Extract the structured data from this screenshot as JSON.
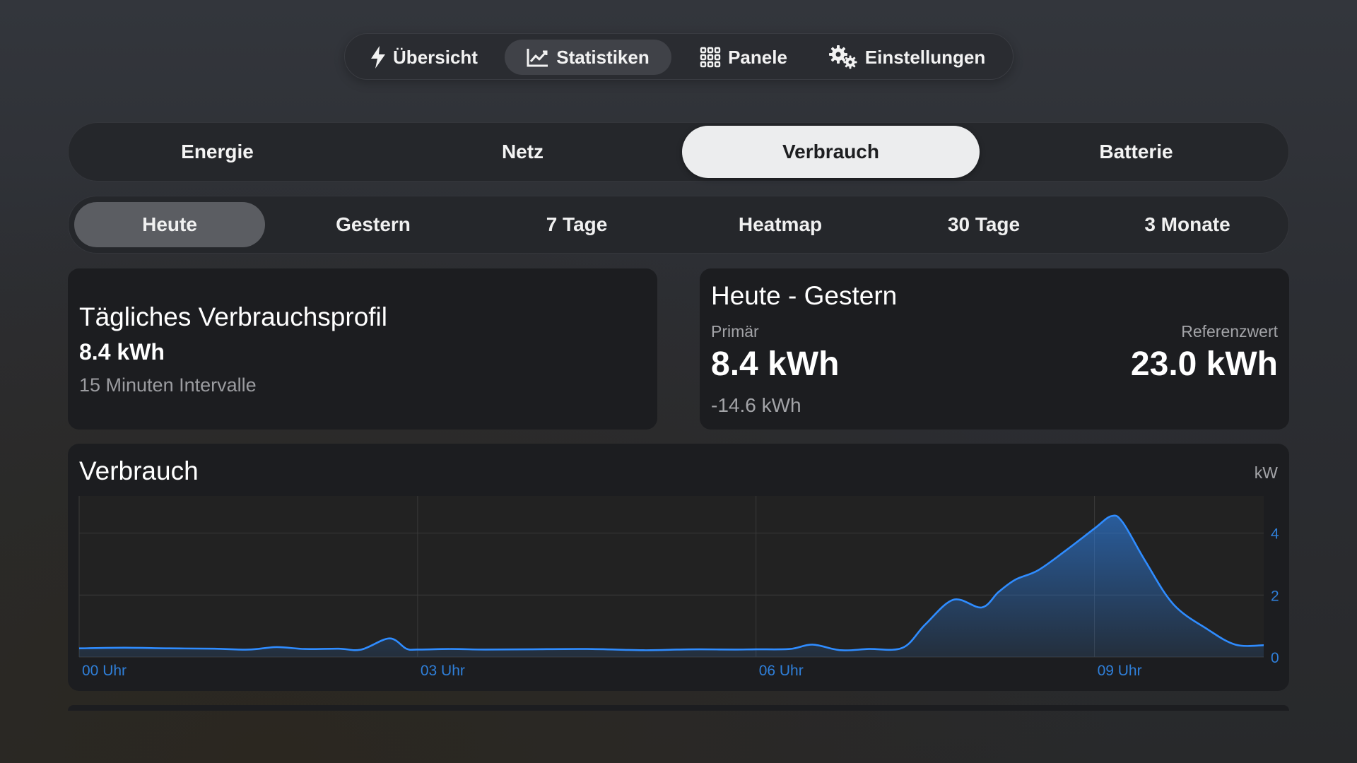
{
  "nav": {
    "items": [
      {
        "label": "Übersicht",
        "icon": "bolt-icon",
        "active": false
      },
      {
        "label": "Statistiken",
        "icon": "chart-line-icon",
        "active": true
      },
      {
        "label": "Panele",
        "icon": "grid-icon",
        "active": false
      },
      {
        "label": "Einstellungen",
        "icon": "gears-icon",
        "active": false
      }
    ]
  },
  "categories": {
    "tabs": [
      "Energie",
      "Netz",
      "Verbrauch",
      "Batterie"
    ],
    "active": "Verbrauch"
  },
  "ranges": {
    "tabs": [
      "Heute",
      "Gestern",
      "7 Tage",
      "Heatmap",
      "30 Tage",
      "3 Monate"
    ],
    "active": "Heute"
  },
  "profile_card": {
    "title": "Tägliches Verbrauchsprofil",
    "value": "8.4 kWh",
    "subtitle": "15 Minuten Intervalle"
  },
  "compare_card": {
    "title": "Heute - Gestern",
    "primary_label": "Primär",
    "primary_value": "8.4 kWh",
    "reference_label": "Referenzwert",
    "reference_value": "23.0 kWh",
    "difference": "-14.6 kWh"
  },
  "chart_card": {
    "title": "Verbrauch",
    "unit": "kW"
  },
  "colors": {
    "accent": "#2f8cff",
    "active_pill": "#ecedee",
    "card": "#1c1d20"
  },
  "chart_data": {
    "type": "area",
    "title": "Verbrauch",
    "ylabel": "kW",
    "ylim": [
      0,
      5.2
    ],
    "yticks": [
      0,
      2,
      4
    ],
    "xticks": [
      {
        "h": 0,
        "label": "00 Uhr"
      },
      {
        "h": 3,
        "label": "03 Uhr"
      },
      {
        "h": 6,
        "label": "06 Uhr"
      },
      {
        "h": 9,
        "label": "09 Uhr"
      }
    ],
    "xlim": [
      0,
      10.5
    ],
    "grid": true,
    "series": [
      {
        "x": [
          0,
          0.4,
          0.8,
          1.2,
          1.5,
          1.75,
          2.0,
          2.3,
          2.5,
          2.75,
          2.9,
          3.0,
          3.3,
          3.6,
          4.0,
          4.5,
          5.0,
          5.3,
          5.5,
          5.8,
          6.0,
          6.3,
          6.5,
          6.75,
          7.0,
          7.3,
          7.5,
          7.75,
          8.0,
          8.15,
          8.3,
          8.5,
          8.75,
          9.0,
          9.15,
          9.25,
          9.45,
          9.7,
          10.0,
          10.25,
          10.5
        ],
        "values": [
          0.28,
          0.3,
          0.28,
          0.27,
          0.24,
          0.32,
          0.26,
          0.27,
          0.24,
          0.6,
          0.27,
          0.24,
          0.26,
          0.24,
          0.25,
          0.26,
          0.22,
          0.24,
          0.25,
          0.24,
          0.25,
          0.26,
          0.4,
          0.22,
          0.26,
          0.3,
          1.05,
          1.85,
          1.6,
          2.1,
          2.5,
          2.8,
          3.45,
          4.15,
          4.55,
          4.35,
          3.1,
          1.7,
          0.9,
          0.4,
          0.38
        ]
      }
    ]
  }
}
